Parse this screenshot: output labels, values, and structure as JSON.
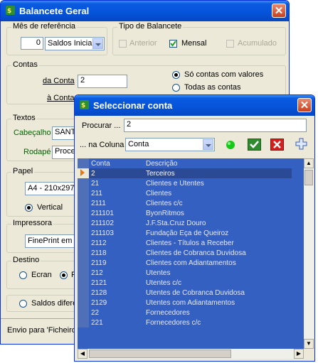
{
  "main_window": {
    "title": "Balancete Geral",
    "mes": {
      "label": "Mês de referência",
      "number": "0",
      "select_value": "Saldos Iniciais"
    },
    "tipo": {
      "label": "Tipo de Balancete",
      "anterior": "Anterior",
      "mensal": "Mensal",
      "acumulado": "Acumulado"
    },
    "contas": {
      "label": "Contas",
      "da_conta_label": "da Conta",
      "da_conta_value": "2",
      "a_conta_label": "à Conta",
      "opt_com_valores": "Só contas com valores",
      "opt_todas": "Todas as contas"
    },
    "textos": {
      "label": "Textos",
      "cabecalho_label": "Cabeçalho",
      "cabecalho_value": "SANTA",
      "rodape_label": "Rodapé",
      "rodape_value": "Processado"
    },
    "papel": {
      "label": "Papel",
      "select_value": "A4 - 210x297",
      "vertical": "Vertical"
    },
    "impressora": {
      "label": "Impressora",
      "select_value": "FinePrint em Fil"
    },
    "destino": {
      "label": "Destino",
      "ecran": "Ecran",
      "f": "F"
    },
    "saldos": "Saldos difere",
    "envio": "Envio para 'Ficheiro"
  },
  "dialog": {
    "title": "Seleccionar conta",
    "procurar_label": "Procurar ...",
    "procurar_value": "2",
    "coluna_label": "... na Coluna",
    "coluna_value": "Conta",
    "headers": {
      "conta": "Conta",
      "descricao": "Descrição"
    },
    "rows": [
      {
        "conta": "2",
        "descricao": "Terceiros"
      },
      {
        "conta": "21",
        "descricao": "Clientes e Utentes"
      },
      {
        "conta": "211",
        "descricao": "Clientes"
      },
      {
        "conta": "2111",
        "descricao": "Clientes c/c"
      },
      {
        "conta": "211101",
        "descricao": "ByonRitmos"
      },
      {
        "conta": "211102",
        "descricao": "J.F.Sta.Cruz Douro"
      },
      {
        "conta": "211103",
        "descricao": "Fundação Eça de Queiroz"
      },
      {
        "conta": "2112",
        "descricao": "Clientes - Títulos a Receber"
      },
      {
        "conta": "2118",
        "descricao": "Clientes de Cobranca Duvidosa"
      },
      {
        "conta": "2119",
        "descricao": "Clientes com Adiantamentos"
      },
      {
        "conta": "212",
        "descricao": "Utentes"
      },
      {
        "conta": "2121",
        "descricao": "Utentes c/c"
      },
      {
        "conta": "2128",
        "descricao": "Utentes de Cobranca Duvidosa"
      },
      {
        "conta": "2129",
        "descricao": "Utentes com Adiantamentos"
      },
      {
        "conta": "22",
        "descricao": "Fornecedores"
      },
      {
        "conta": "221",
        "descricao": "Fornecedores c/c"
      }
    ]
  },
  "colors": {
    "title_blue": "#0553d8",
    "grid_bg": "#3461c1",
    "selected_row": "#2a4a96"
  },
  "icons": [
    "app-icon",
    "close-icon",
    "green-dot-icon",
    "check-icon",
    "red-x-icon",
    "plus-icon",
    "row-pointer-icon"
  ]
}
